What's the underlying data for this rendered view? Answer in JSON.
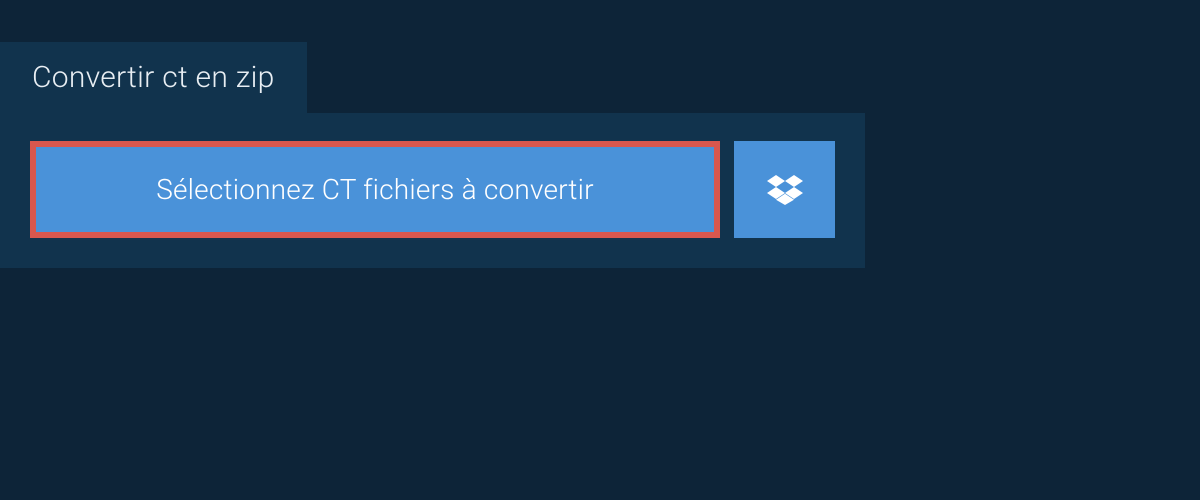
{
  "tab": {
    "title": "Convertir ct en zip"
  },
  "actions": {
    "select_files_label": "Sélectionnez CT fichiers à convertir"
  }
}
